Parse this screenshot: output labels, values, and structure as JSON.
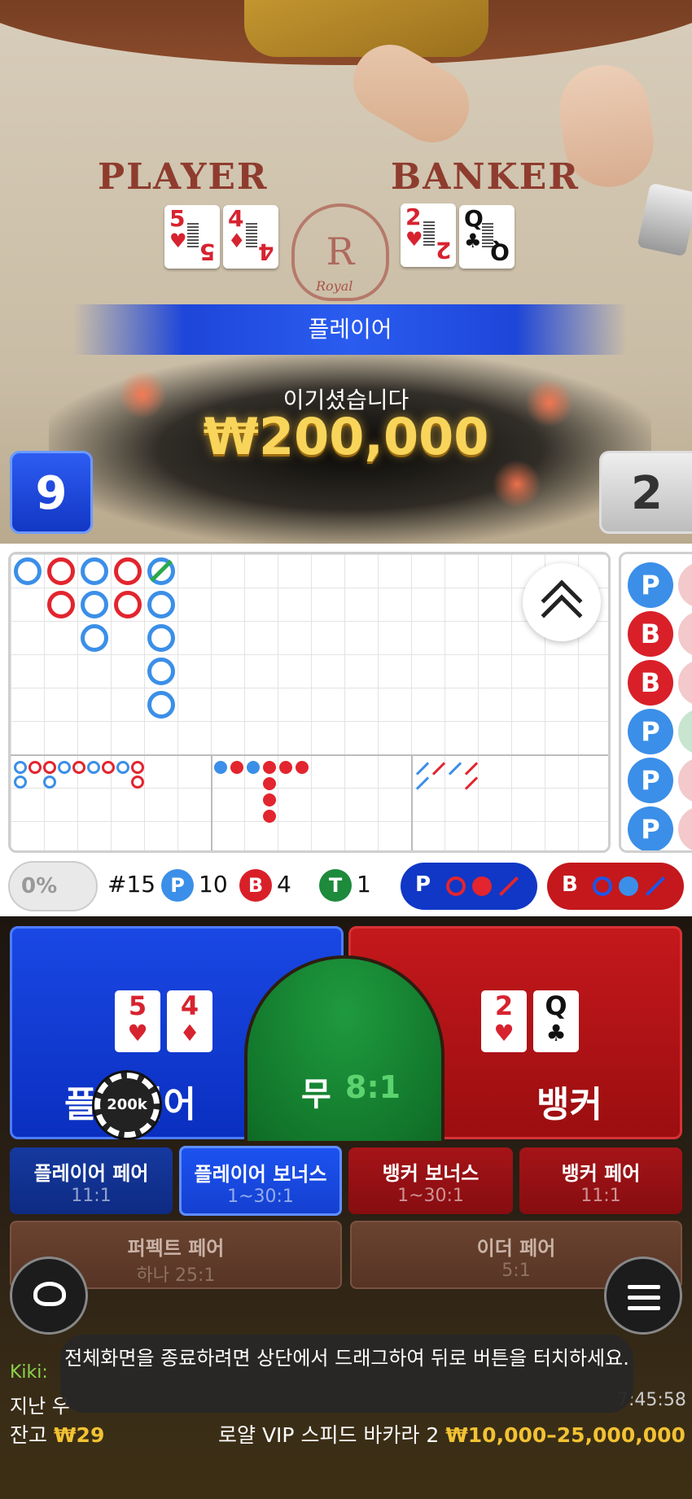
{
  "video": {
    "felt_player": "PLAYER",
    "felt_banker": "BANKER",
    "logo_letter": "R",
    "logo_text": "Royal",
    "player_cards": [
      {
        "rank": "5",
        "suit": "♥"
      },
      {
        "rank": "4",
        "suit": "♦"
      }
    ],
    "banker_cards": [
      {
        "rank": "2",
        "suit": "♥"
      },
      {
        "rank": "Q",
        "suit": "♣"
      }
    ],
    "result_banner": "플레이어",
    "win_label": "이기셨습니다",
    "win_amount": "₩200,000",
    "player_score": "9",
    "banker_score": "2"
  },
  "roadmap": {
    "big_road": [
      [
        "P",
        "B",
        "P",
        "B",
        "T"
      ],
      [
        "",
        "B",
        "P",
        "B",
        "P"
      ],
      [
        "",
        "",
        "P",
        "",
        "P"
      ],
      [
        "",
        "",
        "",
        "",
        "P"
      ],
      [
        "",
        "",
        "",
        "",
        "P"
      ]
    ],
    "bead_column": [
      "P",
      "B",
      "B",
      "P",
      "P",
      "P"
    ],
    "bead_letters": {
      "P": "P",
      "B": "B"
    }
  },
  "stats": {
    "toggle": "0%",
    "round": "#15",
    "p_letter": "P",
    "p_count": "10",
    "b_letter": "B",
    "b_count": "4",
    "t_letter": "T",
    "t_count": "1",
    "pred_player": "P",
    "pred_banker": "B"
  },
  "bets": {
    "player": {
      "label": "플레이어",
      "cards": [
        {
          "rank": "5",
          "suit": "♥"
        },
        {
          "rank": "4",
          "suit": "♦"
        }
      ]
    },
    "tie": {
      "label": "무",
      "odds": "8:1"
    },
    "banker": {
      "label": "뱅커",
      "cards": [
        {
          "rank": "2",
          "suit": "♥"
        },
        {
          "rank": "Q",
          "suit": "♣"
        }
      ]
    },
    "chip": "200k",
    "side": [
      {
        "label": "플레이어 페어",
        "odds": "11:1"
      },
      {
        "label": "플레이어 보너스",
        "odds": "1~30:1"
      },
      {
        "label": "뱅커 보너스",
        "odds": "1~30:1"
      },
      {
        "label": "뱅커 페어",
        "odds": "11:1"
      },
      {
        "label": "퍼펙트 페어",
        "odds": "하나 25:1"
      },
      {
        "label": "이더 페어",
        "odds": "5:1"
      }
    ]
  },
  "footer": {
    "chat_name": "Kiki:",
    "info_line": "지난 우",
    "time": "7:45:58",
    "balance_label": "잔고",
    "balance_value": "₩29",
    "table_name": "로얄 VIP 스피드 바카라 2",
    "table_limits": "₩10,000–25,000,000",
    "toast": "전체화면을 종료하려면 상단에서 드래그하여 뒤로 버튼을 터치하세요."
  },
  "colors": {
    "player": "#1a48e4",
    "banker": "#c4181c",
    "tie": "#1f9a3f",
    "gold": "#f2c233"
  }
}
